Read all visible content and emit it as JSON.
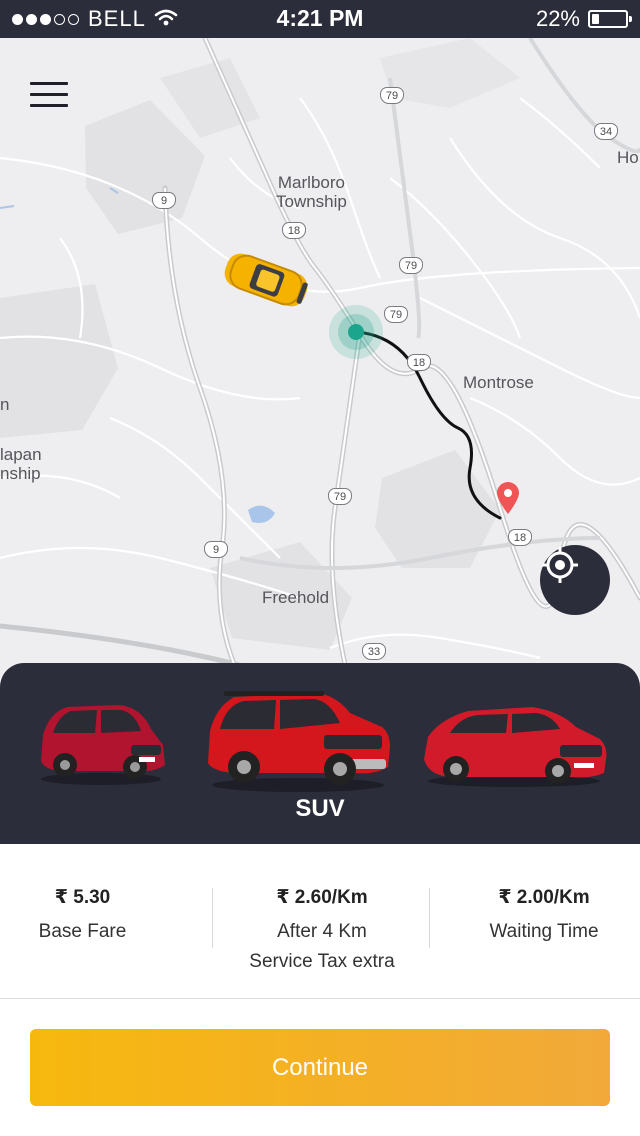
{
  "status_bar": {
    "carrier": "BELL",
    "time": "4:21 PM",
    "battery_percent": "22%",
    "battery_level": 0.22,
    "signal_bars": 3,
    "signal_total": 5
  },
  "map": {
    "place_labels": [
      "Marlboro\nTownship",
      "Montrose",
      "Freehold",
      "lapan\nnship",
      "Ho",
      "n"
    ],
    "route_shields": [
      "79",
      "34",
      "9",
      "18",
      "79",
      "79",
      "18",
      "79",
      "18",
      "9",
      "33"
    ],
    "pickup_marker": "pickup-pulse",
    "destination_marker": "pin-red",
    "colors": {
      "route": "#111111",
      "pickup": "#1aa58c",
      "destination": "#f05454"
    }
  },
  "vehicles": {
    "selected_label": "SUV",
    "items": [
      {
        "name": "hatchback-left",
        "color": "#b0142e"
      },
      {
        "name": "suv-center",
        "color": "#d4161d"
      },
      {
        "name": "hatchback-right",
        "color": "#d21b2a"
      }
    ]
  },
  "fares": [
    {
      "value": "₹ 5.30",
      "label": "Base Fare",
      "sub": ""
    },
    {
      "value": "₹ 2.60/Km",
      "label": "After 4 Km",
      "sub": "Service Tax extra"
    },
    {
      "value": "₹ 2.00/Km",
      "label": "Waiting Time",
      "sub": ""
    }
  ],
  "continue_label": "Continue",
  "colors": {
    "dark_panel": "#2c2d3a",
    "accent_start": "#f7b80e",
    "accent_end": "#f2a93a"
  }
}
